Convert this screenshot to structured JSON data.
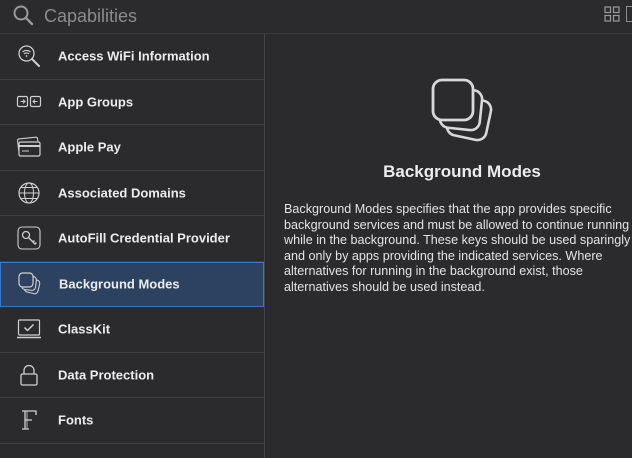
{
  "search": {
    "placeholder": "Capabilities"
  },
  "sidebar": {
    "items": [
      {
        "label": "Access WiFi Information",
        "icon": "wifi-search-icon"
      },
      {
        "label": "App Groups",
        "icon": "app-groups-icon"
      },
      {
        "label": "Apple Pay",
        "icon": "wallet-icon"
      },
      {
        "label": "Associated Domains",
        "icon": "globe-icon"
      },
      {
        "label": "AutoFill Credential Provider",
        "icon": "key-icon"
      },
      {
        "label": "Background Modes",
        "icon": "background-modes-icon",
        "selected": true
      },
      {
        "label": "ClassKit",
        "icon": "classkit-icon"
      },
      {
        "label": "Data Protection",
        "icon": "lock-icon"
      },
      {
        "label": "Fonts",
        "icon": "fonts-icon"
      }
    ]
  },
  "detail": {
    "title": "Background Modes",
    "description": "Background Modes specifies that the app provides specific background services and must be allowed to continue running while in the background. These keys should be used sparingly and only by apps providing the indicated services. Where alternatives for running in the background exist, those alternatives should be used instead."
  },
  "colors": {
    "background": "#2b2b2d",
    "selected_background": "#2c4260",
    "selected_border": "#3c76bd"
  }
}
